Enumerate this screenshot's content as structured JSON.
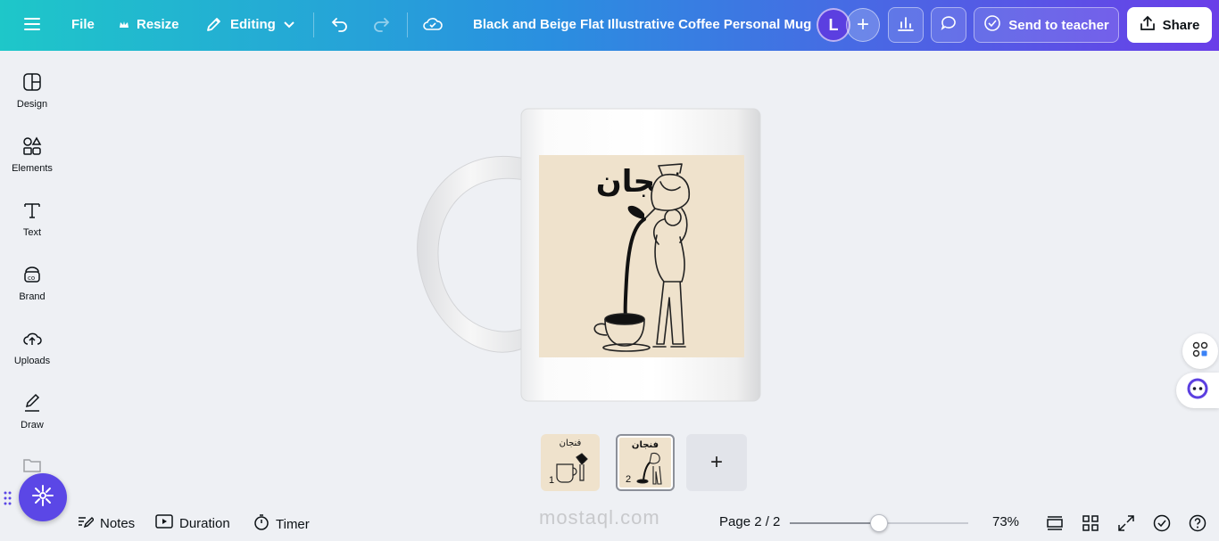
{
  "topbar": {
    "file_label": "File",
    "resize_label": "Resize",
    "editing_label": "Editing",
    "doc_title": "Black and Beige Flat Illustrative Coffee Personal Mug",
    "avatar_initial": "L",
    "avatar_add": "+",
    "send_label": "Send to teacher",
    "share_label": "Share"
  },
  "sidebar": {
    "items": [
      {
        "label": "Design",
        "icon": "design-icon"
      },
      {
        "label": "Elements",
        "icon": "elements-icon"
      },
      {
        "label": "Text",
        "icon": "text-icon"
      },
      {
        "label": "Brand",
        "icon": "brand-icon"
      },
      {
        "label": "Uploads",
        "icon": "uploads-icon"
      },
      {
        "label": "Draw",
        "icon": "draw-icon"
      }
    ]
  },
  "design": {
    "mug_text": "فنجان",
    "background_color": "#efe2cc"
  },
  "pages": {
    "thumbs": [
      {
        "label": "فنجان",
        "number": "1"
      },
      {
        "label": "فنجان",
        "number": "2"
      }
    ],
    "add_label": "+"
  },
  "bottombar": {
    "notes_label": "Notes",
    "duration_label": "Duration",
    "timer_label": "Timer",
    "page_indicator": "Page 2 / 2",
    "zoom_label": "73%",
    "zoom_value": 0.5
  },
  "watermark": "mostaql.com"
}
